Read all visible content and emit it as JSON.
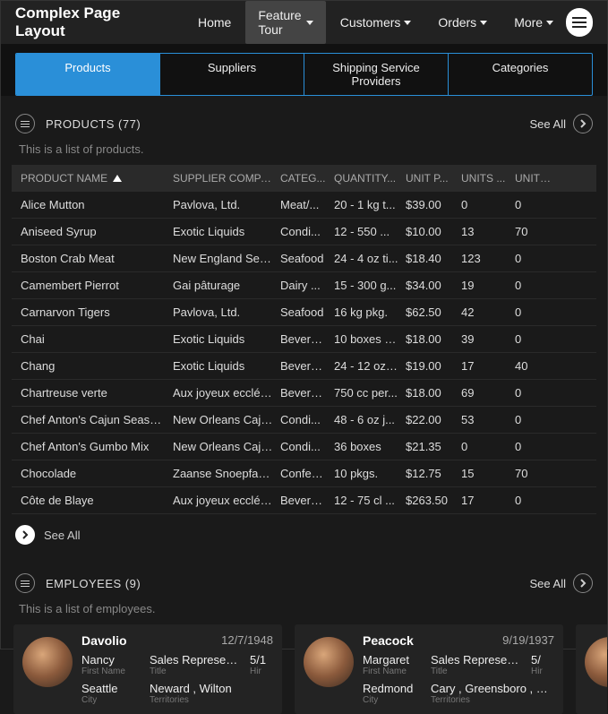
{
  "brand": "Complex Page Layout",
  "nav": {
    "items": [
      {
        "label": "Home",
        "dropdown": false,
        "active": false
      },
      {
        "label": "Feature Tour",
        "dropdown": true,
        "active": true
      },
      {
        "label": "Customers",
        "dropdown": true,
        "active": false
      },
      {
        "label": "Orders",
        "dropdown": true,
        "active": false
      },
      {
        "label": "More",
        "dropdown": true,
        "active": false
      }
    ]
  },
  "tabs": [
    {
      "label": "Products",
      "active": true
    },
    {
      "label": "Suppliers",
      "active": false
    },
    {
      "label": "Shipping Service Providers",
      "active": false
    },
    {
      "label": "Categories",
      "active": false
    }
  ],
  "products_section": {
    "title": "PRODUCTS (77)",
    "see_all": "See All",
    "desc": "This is a list of products.",
    "columns": [
      "PRODUCT NAME",
      "SUPPLIER COMPA...",
      "CATEG...",
      "QUANTITY...",
      "UNIT P...",
      "UNITS ...",
      "UNITS ..."
    ],
    "rows": [
      {
        "c": [
          "Alice Mutton",
          "Pavlova, Ltd.",
          "Meat/...",
          "20 - 1 kg t...",
          "$39.00",
          "0",
          "0"
        ]
      },
      {
        "c": [
          "Aniseed Syrup",
          "Exotic Liquids",
          "Condi...",
          "12 - 550 ...",
          "$10.00",
          "13",
          "70"
        ]
      },
      {
        "c": [
          "Boston Crab Meat",
          "New England Seaf...",
          "Seafood",
          "24 - 4 oz ti...",
          "$18.40",
          "123",
          "0"
        ]
      },
      {
        "c": [
          "Camembert Pierrot",
          "Gai pâturage",
          "Dairy ...",
          "15 - 300 g...",
          "$34.00",
          "19",
          "0"
        ]
      },
      {
        "c": [
          "Carnarvon Tigers",
          "Pavlova, Ltd.",
          "Seafood",
          "16 kg pkg.",
          "$62.50",
          "42",
          "0"
        ]
      },
      {
        "c": [
          "Chai",
          "Exotic Liquids",
          "Bevera...",
          "10 boxes x...",
          "$18.00",
          "39",
          "0"
        ]
      },
      {
        "c": [
          "Chang",
          "Exotic Liquids",
          "Bevera...",
          "24 - 12 oz ...",
          "$19.00",
          "17",
          "40"
        ]
      },
      {
        "c": [
          "Chartreuse verte",
          "Aux joyeux ecclési...",
          "Bevera...",
          "750 cc per...",
          "$18.00",
          "69",
          "0"
        ]
      },
      {
        "c": [
          "Chef Anton's Cajun Seaso...",
          "New Orleans Caju...",
          "Condi...",
          "48 - 6 oz j...",
          "$22.00",
          "53",
          "0"
        ]
      },
      {
        "c": [
          "Chef Anton's Gumbo Mix",
          "New Orleans Caju...",
          "Condi...",
          "36 boxes",
          "$21.35",
          "0",
          "0"
        ]
      },
      {
        "c": [
          "Chocolade",
          "Zaanse Snoepfabri...",
          "Confec...",
          "10 pkgs.",
          "$12.75",
          "15",
          "70"
        ]
      },
      {
        "c": [
          "Côte de Blaye",
          "Aux joyeux ecclési...",
          "Bevera...",
          "12 - 75 cl ...",
          "$263.50",
          "17",
          "0"
        ]
      }
    ],
    "footer_see_all": "See All"
  },
  "employees_section": {
    "title": "EMPLOYEES (9)",
    "see_all": "See All",
    "desc": "This is a list of employees.",
    "labels": {
      "first_name": "First Name",
      "title": "Title",
      "hire": "Hir",
      "city": "City",
      "territories": "Territories"
    },
    "cards": [
      {
        "last": "Davolio",
        "date": "12/7/1948",
        "first": "Nancy",
        "title_val": "Sales Representative",
        "hire": "5/1",
        "city": "Seattle",
        "terr": "Neward , Wilton"
      },
      {
        "last": "Peacock",
        "date": "9/19/1937",
        "first": "Margaret",
        "title_val": "Sales Representative",
        "hire": "5/",
        "city": "Redmond",
        "terr": "Cary , Greensboro , Rock"
      }
    ]
  }
}
